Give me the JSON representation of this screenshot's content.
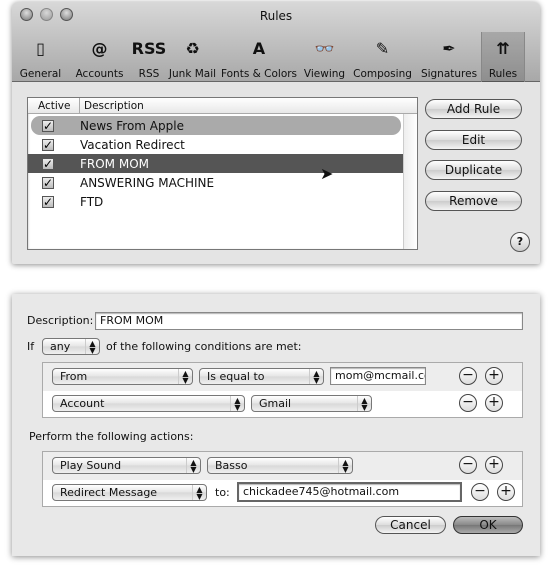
{
  "window": {
    "title": "Rules"
  },
  "toolbar": [
    {
      "label": "General",
      "icon": "light-switch-icon",
      "glyph": "▯"
    },
    {
      "label": "Accounts",
      "icon": "at-sign-icon",
      "glyph": "@"
    },
    {
      "label": "RSS",
      "icon": "rss-icon",
      "glyph": "RSS"
    },
    {
      "label": "Junk Mail",
      "icon": "junk-mail-bin-icon",
      "glyph": "♻"
    },
    {
      "label": "Fonts & Colors",
      "icon": "font-icon",
      "glyph": "A"
    },
    {
      "label": "Viewing",
      "icon": "glasses-icon",
      "glyph": "👓"
    },
    {
      "label": "Composing",
      "icon": "pencil-paper-icon",
      "glyph": "✎"
    },
    {
      "label": "Signatures",
      "icon": "pen-signature-icon",
      "glyph": "✒"
    },
    {
      "label": "Rules",
      "icon": "rules-arrows-icon",
      "glyph": "⇈"
    }
  ],
  "rules_list": {
    "columns": [
      "Active",
      "Description"
    ],
    "rows": [
      {
        "active": true,
        "description": "News From Apple"
      },
      {
        "active": true,
        "description": "Vacation Redirect"
      },
      {
        "active": true,
        "description": "FROM MOM"
      },
      {
        "active": true,
        "description": "ANSWERING MACHINE"
      },
      {
        "active": true,
        "description": "FTD"
      }
    ],
    "selected": "FROM MOM"
  },
  "buttons": {
    "add_rule": "Add Rule",
    "edit": "Edit",
    "duplicate": "Duplicate",
    "remove": "Remove",
    "help": "?"
  },
  "sheet": {
    "description_label": "Description:",
    "description_value": "FROM MOM",
    "if_label": "If",
    "match_value": "any",
    "conditions_label": "of the following conditions are met:",
    "conditions": [
      {
        "field": "From",
        "operator": "Is equal to",
        "value": "mom@mcmail.com"
      },
      {
        "field": "Account",
        "value": "Gmail"
      }
    ],
    "actions_label": "Perform the following actions:",
    "actions": [
      {
        "action": "Play Sound",
        "value": "Basso"
      },
      {
        "action": "Redirect Message",
        "to_label": "to:",
        "value": "chickadee745@hotmail.com"
      }
    ],
    "minus": "−",
    "plus": "+",
    "cancel": "Cancel",
    "ok": "OK"
  }
}
